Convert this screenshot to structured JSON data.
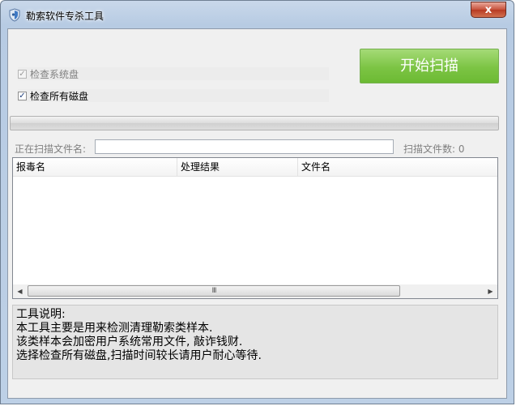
{
  "window": {
    "title": "勒索软件专杀工具",
    "close_glyph": "x"
  },
  "options": [
    {
      "label": "检查系统盘",
      "checked": true,
      "enabled": false
    },
    {
      "label": "检查所有磁盘",
      "checked": true,
      "enabled": true
    }
  ],
  "start_button": {
    "label": "开始扫描"
  },
  "progress": {
    "fraction": 0
  },
  "scan": {
    "file_label": "正在扫描文件名:",
    "file_value": "",
    "count_label": "扫描文件数:",
    "count_value": "0"
  },
  "table": {
    "columns": [
      "报毒名",
      "处理结果",
      "文件名"
    ],
    "rows": [],
    "scroll_thumb_glyph": "III"
  },
  "info": {
    "lines": [
      "工具说明:",
      "本工具主要是用来检测清理勒索类样本.",
      "该类样本会加密用户系统常用文件, 敲诈钱财.",
      "选择检查所有磁盘,扫描时间较长请用户耐心等待."
    ]
  },
  "colors": {
    "start_button": "#7cc444",
    "close_button": "#c7503a",
    "title_bar": "#b7cbe3"
  },
  "icons": {
    "app": "shield-icon",
    "close": "close-icon",
    "scroll_left": "arrow-left-icon",
    "scroll_right": "arrow-right-icon"
  }
}
